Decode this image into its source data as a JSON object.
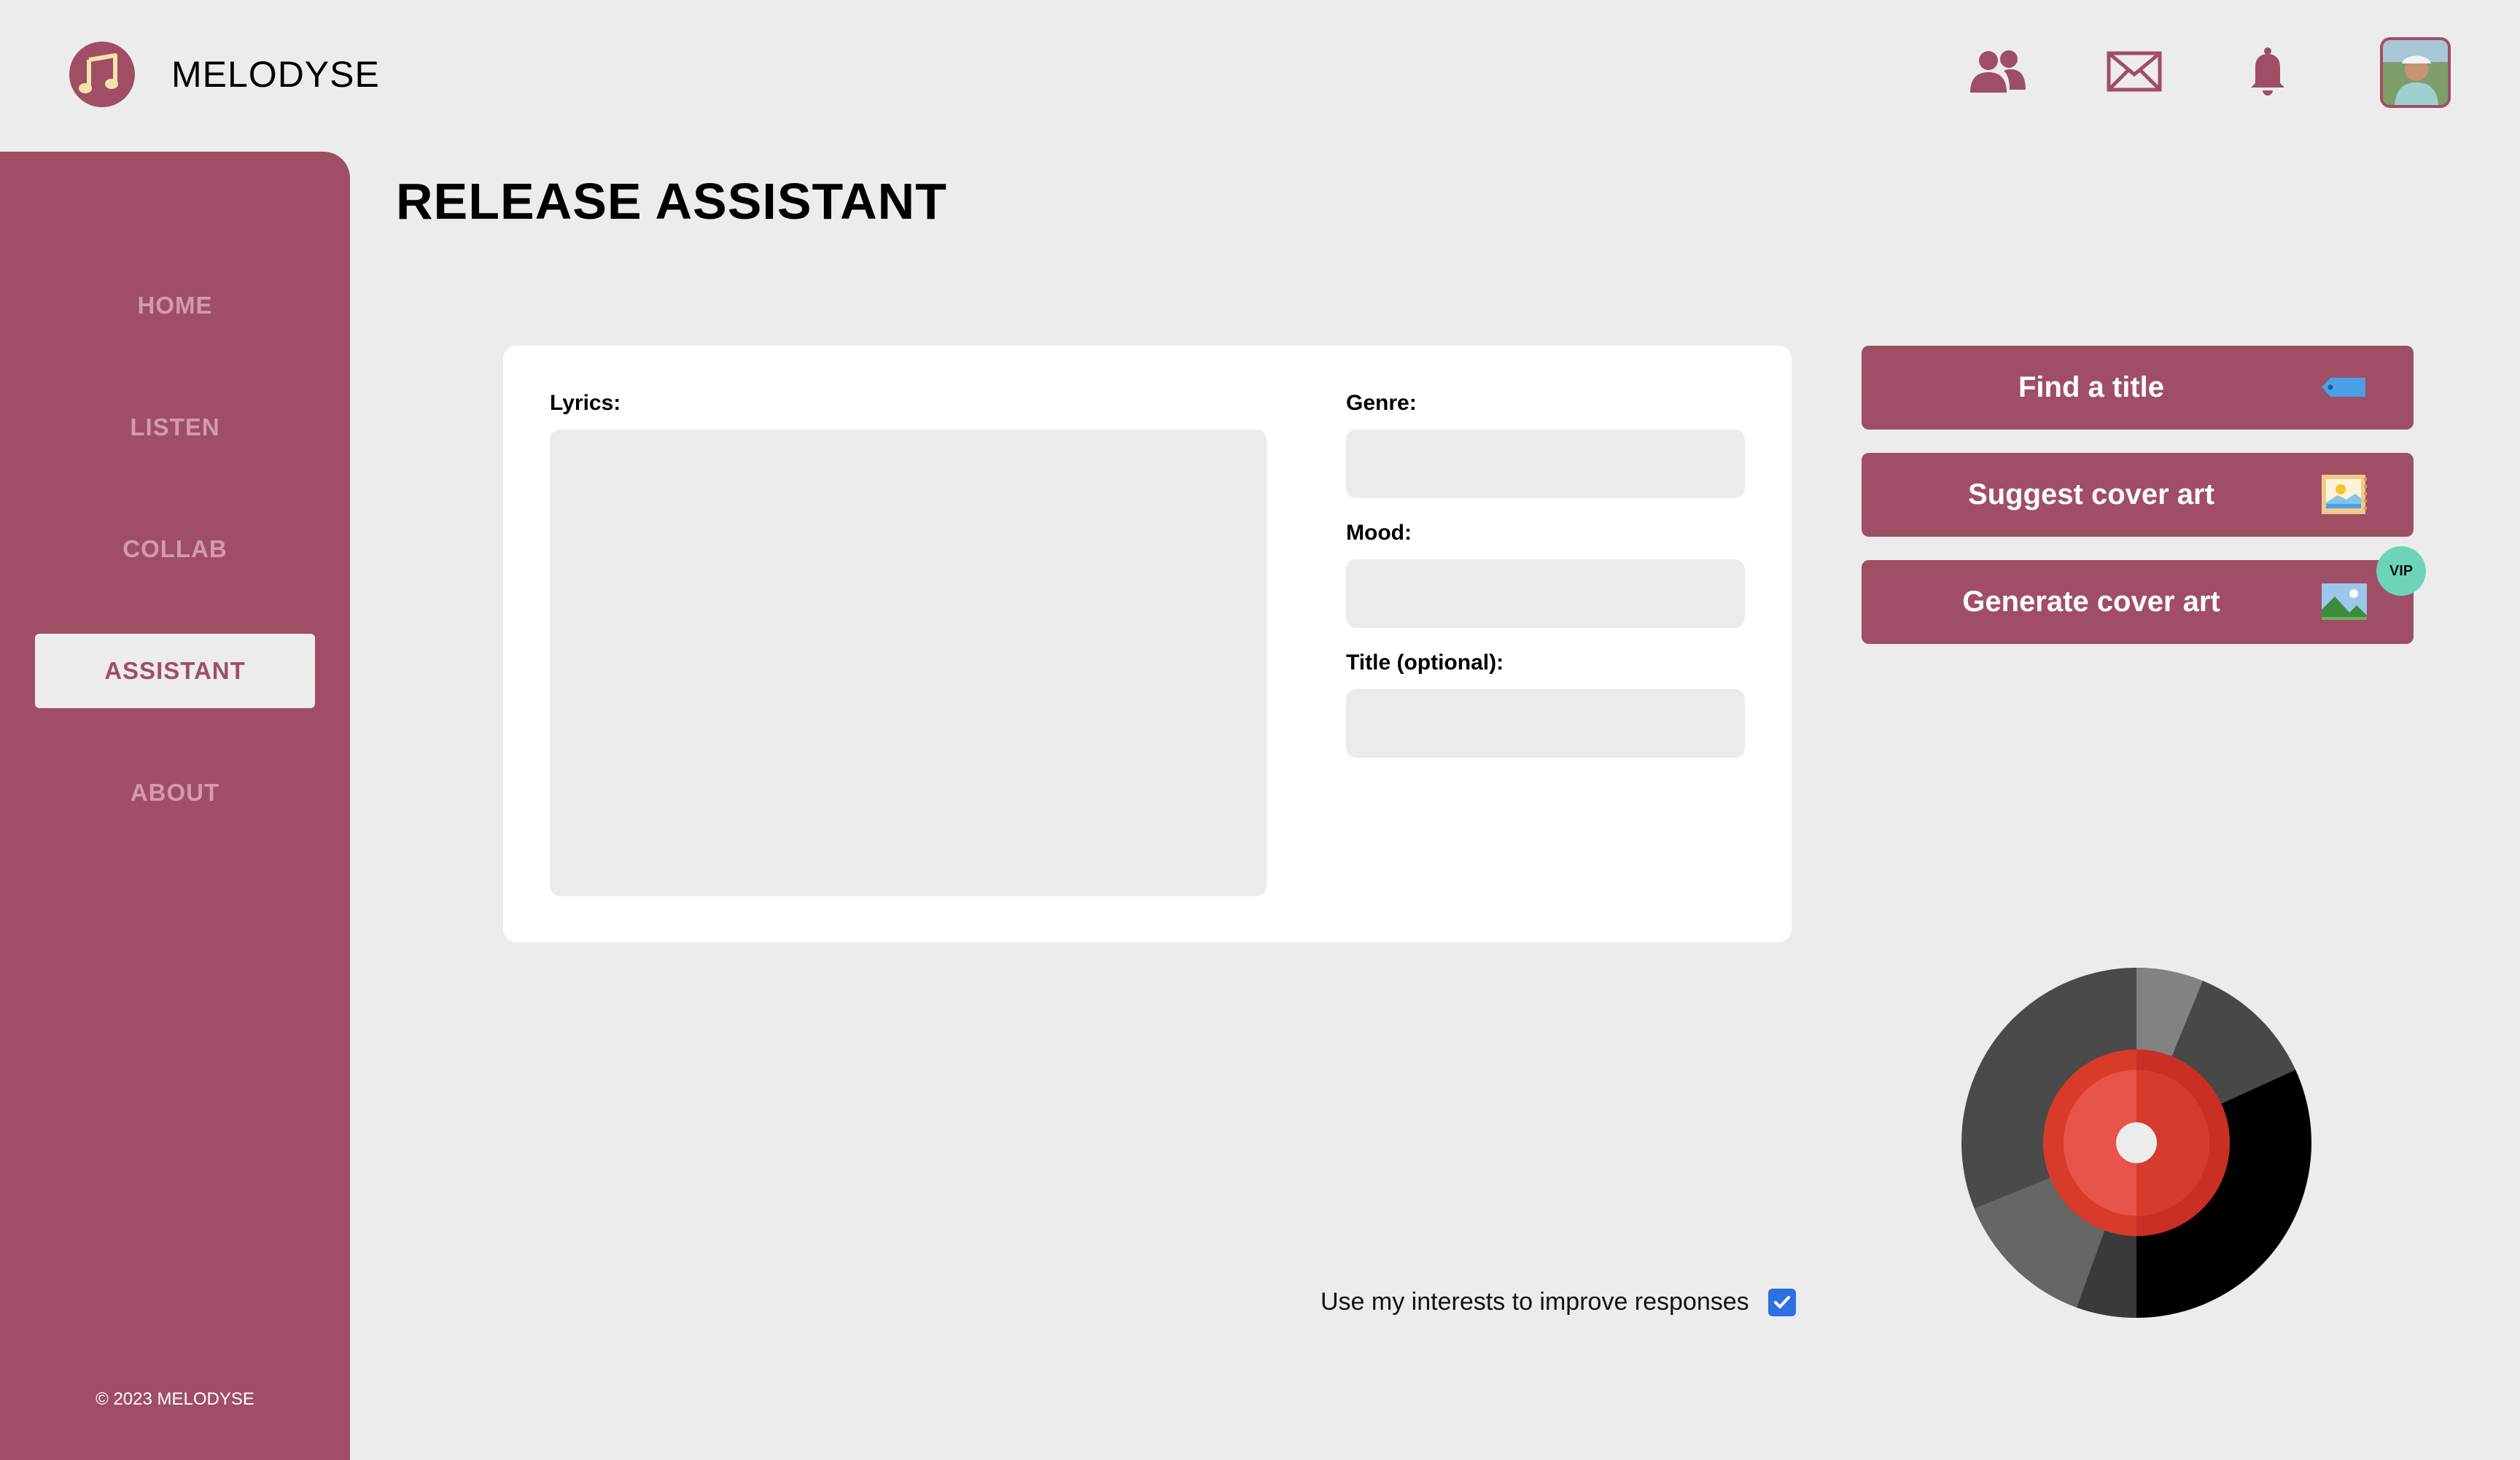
{
  "app": {
    "name": "MELODYSE"
  },
  "header": {
    "icons": [
      "people-icon",
      "mail-icon",
      "bell-icon",
      "user-avatar"
    ]
  },
  "sidebar": {
    "items": [
      {
        "label": "HOME",
        "active": false
      },
      {
        "label": "LISTEN",
        "active": false
      },
      {
        "label": "COLLAB",
        "active": false
      },
      {
        "label": "ASSISTANT",
        "active": true
      },
      {
        "label": "ABOUT",
        "active": false
      }
    ],
    "copyright": "© 2023 MELODYSE"
  },
  "main": {
    "title": "RELEASE ASSISTANT",
    "form": {
      "lyrics_label": "Lyrics:",
      "lyrics_value": "",
      "genre_label": "Genre:",
      "genre_value": "",
      "mood_label": "Mood:",
      "mood_value": "",
      "title_label": "Title (optional):",
      "title_value": ""
    },
    "actions": [
      {
        "label": "Find a title",
        "icon": "tag-icon"
      },
      {
        "label": "Suggest cover art",
        "icon": "sketchbook-icon"
      },
      {
        "label": "Generate cover art",
        "icon": "image-icon",
        "badge": "VIP"
      }
    ],
    "consent": {
      "label": "Use my interests to improve responses",
      "checked": true
    }
  },
  "colors": {
    "brand": "#a04e65",
    "background": "#ececec",
    "vip": "#6cd5b7",
    "checkbox": "#2f6fe4"
  }
}
